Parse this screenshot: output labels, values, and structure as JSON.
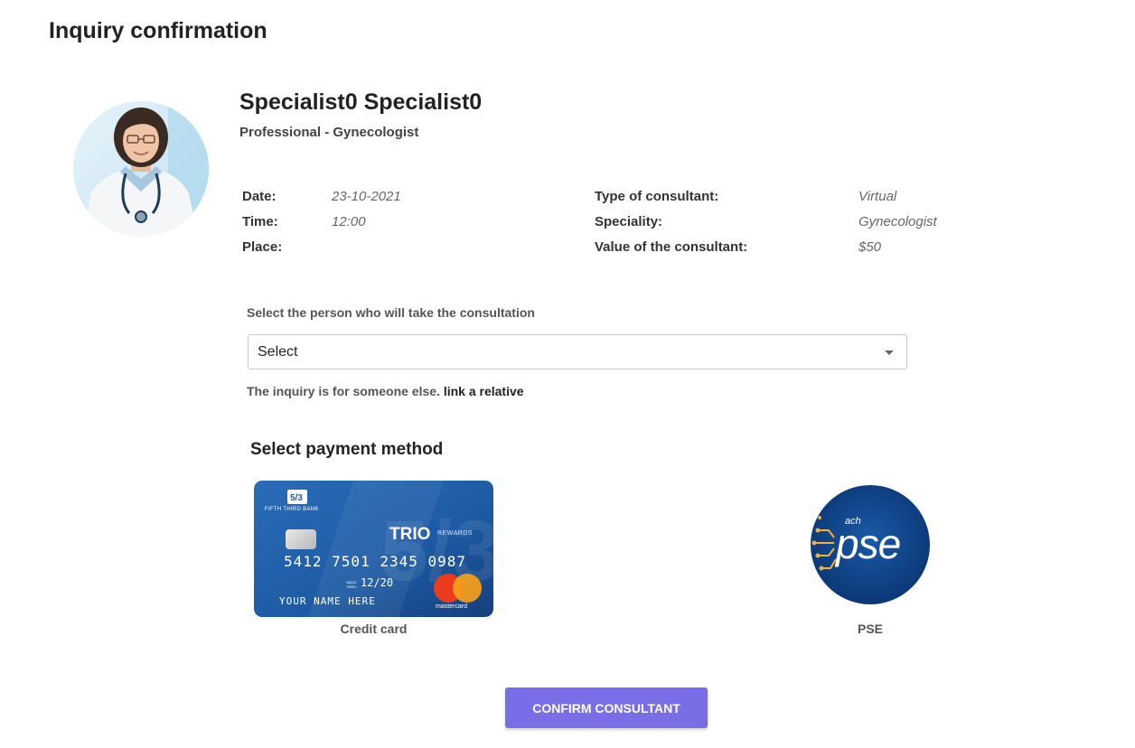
{
  "page": {
    "title": "Inquiry confirmation"
  },
  "doctor": {
    "name": "Specialist0 Specialist0",
    "role": "Professional - Gynecologist"
  },
  "details": {
    "date_label": "Date:",
    "date_value": "23-10-2021",
    "time_label": "Time:",
    "time_value": "12:00",
    "place_label": "Place:",
    "place_value": "",
    "type_label": "Type of consultant:",
    "type_value": "Virtual",
    "speciality_label": "Speciality:",
    "speciality_value": "Gynecologist",
    "value_label": "Value of the consultant:",
    "value_value": "$50"
  },
  "person_select": {
    "label": "Select the person who will take the consultation",
    "selected": "Select"
  },
  "relative": {
    "text": "The inquiry is for someone else.",
    "link": "link a relative"
  },
  "payment": {
    "title": "Select payment method",
    "credit_card": {
      "label": "Credit card",
      "bank": "FIFTH THIRD BANK",
      "brand": "TRIO",
      "rewards": "REWARDS",
      "number": "5412 7501 2345 0987",
      "valid_thru_label": "VALID THRU",
      "expiry": "12/20",
      "holder": "YOUR NAME HERE",
      "network": "mastercard"
    },
    "pse": {
      "label": "PSE",
      "logo_small": "ach",
      "logo_text": "pse"
    }
  },
  "actions": {
    "confirm": "CONFIRM CONSULTANT"
  },
  "colors": {
    "primary_button": "#7a6ee6",
    "pse_blue": "#0b3d7a",
    "card_blue": "#1d5fa8"
  }
}
